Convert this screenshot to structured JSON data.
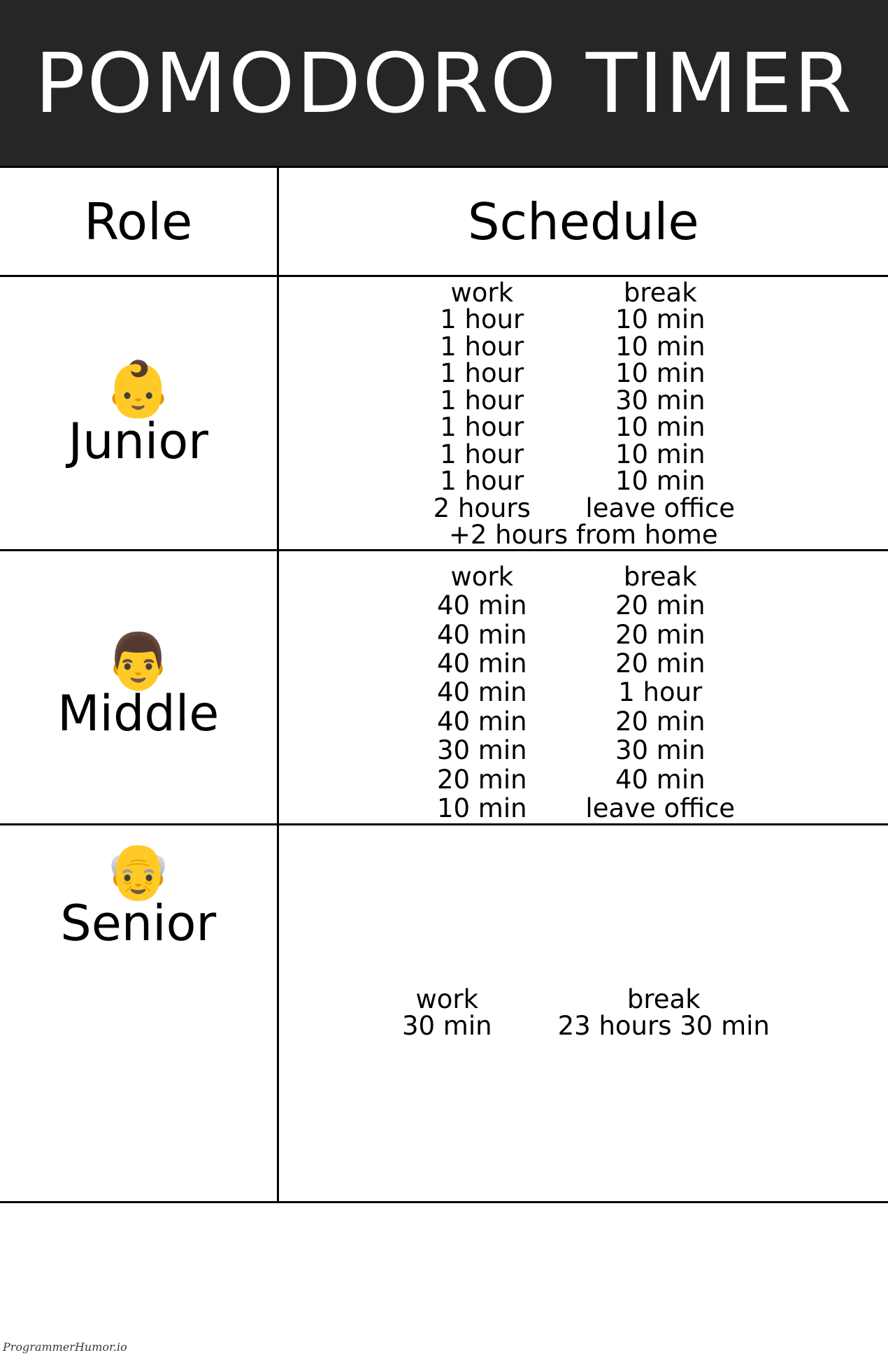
{
  "banner": {
    "title": "POMODORO TIMER"
  },
  "table": {
    "columns": [
      {
        "header": "Role"
      },
      {
        "header": "Schedule"
      }
    ],
    "column_labels": {
      "work": "work",
      "break": "break"
    },
    "rows": [
      {
        "role": "Junior",
        "emoji": "👶",
        "emoji_name": "baby-face-emoji",
        "schedule": [
          {
            "work": "work",
            "break": "break",
            "is_label": true
          },
          {
            "work": "1 hour",
            "break": "10 min"
          },
          {
            "work": "1 hour",
            "break": "10 min"
          },
          {
            "work": "1 hour",
            "break": "10 min"
          },
          {
            "work": "1 hour",
            "break": "30 min"
          },
          {
            "work": "1 hour",
            "break": "10 min"
          },
          {
            "work": "1 hour",
            "break": "10 min"
          },
          {
            "work": "1 hour",
            "break": "10 min"
          },
          {
            "work": "2 hours",
            "break": "leave office"
          }
        ],
        "footnote": "+2 hours from home"
      },
      {
        "role": "Middle",
        "emoji": "👨",
        "emoji_name": "man-face-emoji",
        "schedule": [
          {
            "work": "work",
            "break": "break",
            "is_label": true
          },
          {
            "work": "40 min",
            "break": "20 min"
          },
          {
            "work": "40 min",
            "break": "20 min"
          },
          {
            "work": "40 min",
            "break": "20 min"
          },
          {
            "work": "40 min",
            "break": "1 hour"
          },
          {
            "work": "40 min",
            "break": "20 min"
          },
          {
            "work": "30 min",
            "break": "30 min"
          },
          {
            "work": "20 min",
            "break": "40 min"
          },
          {
            "work": "10 min",
            "break": "leave office"
          }
        ],
        "footnote": ""
      },
      {
        "role": "Senior",
        "emoji": "👴",
        "emoji_name": "old-man-face-emoji",
        "schedule": [
          {
            "work": "work",
            "break": "break",
            "is_label": true
          },
          {
            "work": "30 min",
            "break": "23 hours 30 min"
          }
        ],
        "footnote": ""
      }
    ]
  },
  "watermark": {
    "text": "ProgrammerHumor.io"
  },
  "colors": {
    "banner_background": "#262626",
    "banner_text": "#ffffff",
    "page_background": "#ffffff",
    "border": "#000000",
    "text": "#000000"
  }
}
